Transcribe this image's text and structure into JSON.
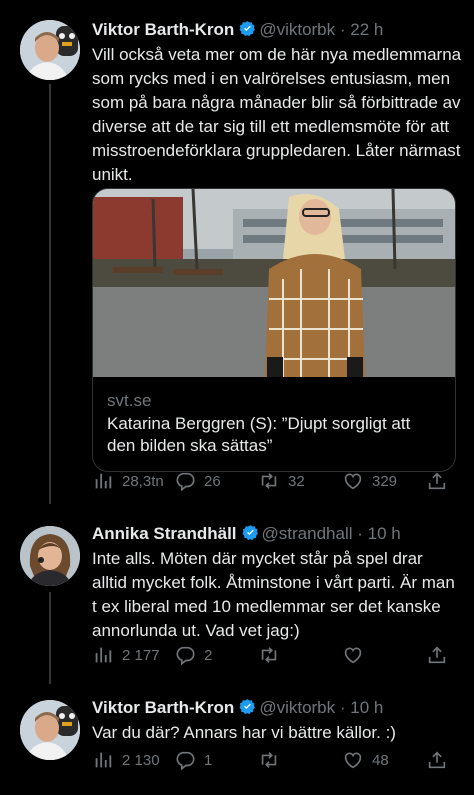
{
  "tweets": [
    {
      "name": "Viktor Barth-Kron",
      "handle": "@viktorbk",
      "sep": "·",
      "time": "22 h",
      "text": "Vill också veta mer om de här nya medlemmarna som rycks med i en valrörelses entusiasm, men som på bara några månader blir så förbittrade av diverse att de tar sig till ett medlemsmöte för att misstroendeförklara gruppledaren. Låter närmast unikt.",
      "card": {
        "domain": "svt.se",
        "title": "Katarina Berggren (S): ”Djupt sorgligt att den bilden ska sättas”"
      },
      "stats": {
        "views": "28,3tn",
        "replies": "26",
        "retweets": "32",
        "likes": "329"
      }
    },
    {
      "name": "Annika Strandhäll",
      "handle": "@strandhall",
      "sep": "·",
      "time": "10 h",
      "text": "Inte alls. Möten där mycket står på spel drar alltid mycket folk. Åtminstone i vårt parti. Är man t ex liberal med 10 medlemmar ser det kanske annorlunda ut. Vad vet jag:)",
      "stats": {
        "views": "2 177",
        "replies": "2",
        "retweets": "",
        "likes": ""
      }
    },
    {
      "name": "Viktor Barth-Kron",
      "handle": "@viktorbk",
      "sep": "·",
      "time": "10 h",
      "text": "Var du där? Annars har vi bättre källor. :)",
      "stats": {
        "views": "2 130",
        "replies": "1",
        "retweets": "",
        "likes": "48"
      }
    }
  ],
  "icons": [
    "verified-badge-icon",
    "views-icon",
    "reply-icon",
    "retweet-icon",
    "like-icon",
    "share-icon"
  ],
  "colors": {
    "background": "#000000",
    "text": "#e7e9ea",
    "muted": "#71767b",
    "verified": "#1d9bf0",
    "border": "#2f3336"
  }
}
